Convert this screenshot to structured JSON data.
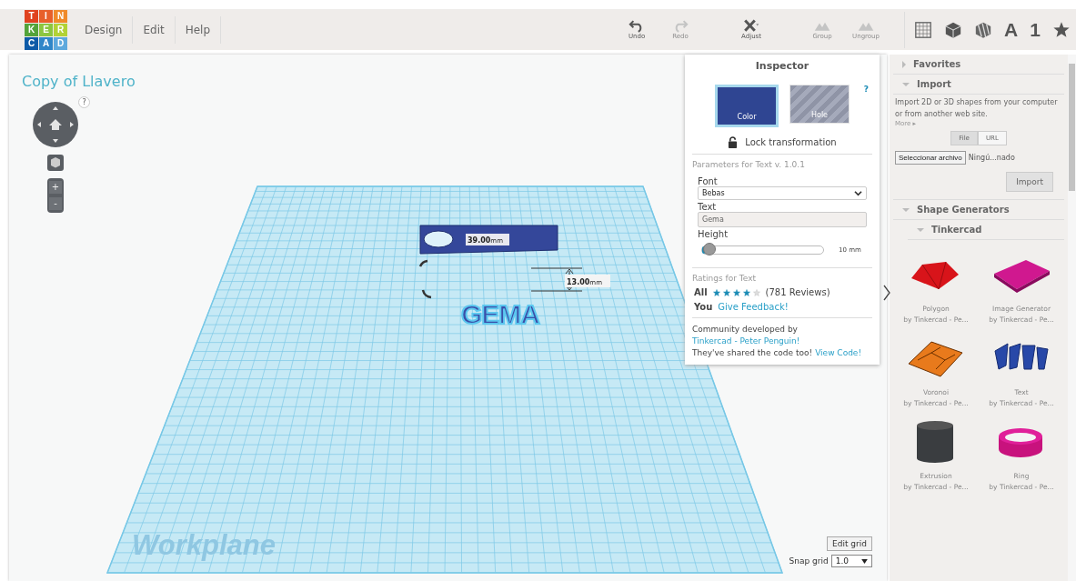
{
  "logo": {
    "letters": [
      "T",
      "I",
      "N",
      "K",
      "E",
      "R",
      "C",
      "A",
      "D"
    ]
  },
  "menu": [
    "Design",
    "Edit",
    "Help"
  ],
  "toolbar": [
    {
      "kind": "undo",
      "label": "Undo",
      "disabled": false
    },
    {
      "kind": "redo",
      "label": "Redo",
      "disabled": true
    },
    {
      "kind": "adjust",
      "label": "Adjust",
      "disabled": false
    },
    {
      "kind": "group",
      "label": "Group",
      "disabled": true
    },
    {
      "kind": "ungroup",
      "label": "Ungroup",
      "disabled": true
    }
  ],
  "view_tabs": [
    {
      "kind": "grid"
    },
    {
      "kind": "cube"
    },
    {
      "kind": "striped"
    },
    {
      "kind": "letter",
      "label": "A"
    },
    {
      "kind": "letter",
      "label": "1"
    },
    {
      "kind": "star"
    }
  ],
  "design_title": "Copy of Llavero",
  "nav": {
    "help": "?",
    "zoom_in": "+",
    "zoom_out": "-"
  },
  "workplane": {
    "label": "Workplane",
    "object_text": "GEMA",
    "width_dim": "39.00",
    "width_unit": "mm",
    "height_dim": "13.00",
    "height_unit": "mm",
    "edit_grid": "Edit grid",
    "snap_label": "Snap grid",
    "snap_value": "1.0"
  },
  "inspector": {
    "title": "Inspector",
    "help": "?",
    "modes": [
      {
        "kind": "color",
        "label": "Color",
        "selected": true
      },
      {
        "kind": "hole",
        "label": "Hole",
        "selected": false
      }
    ],
    "lock": "Lock transformation",
    "params_title": "Parameters for Text v. 1.0.1",
    "font_label": "Font",
    "font_value": "Bebas",
    "text_label": "Text",
    "text_value": "Gema",
    "height": {
      "label": "Height",
      "level": 0.03,
      "reading": "10 mm"
    },
    "ratings_title": "Ratings for Text",
    "all_label": "All",
    "stars": 4,
    "reviews": "(781 Reviews)",
    "you_label": "You",
    "feedback": "Give Feedback!",
    "credit": [
      {
        "text": "Community developed by",
        "link": false
      },
      {
        "text": "Tinkercad - Peter Penguin!",
        "link": true
      }
    ],
    "share": [
      {
        "text": "They've shared the code too!",
        "link": false
      },
      {
        "text": "View Code!",
        "link": true
      }
    ]
  },
  "sidebar": {
    "favorites": {
      "label": "Favorites",
      "expanded": false
    },
    "import": {
      "label": "Import",
      "expanded": true,
      "description": "Import 2D or 3D shapes from your computer or from another web site.",
      "more": "More ▸",
      "sources": [
        {
          "label": "File",
          "selected": true
        },
        {
          "label": "URL",
          "selected": false
        }
      ],
      "choose_file": "Seleccionar archivo",
      "file_status": "Ningú...nado",
      "import_button": "Import"
    },
    "generators": {
      "label": "Shape Generators",
      "expanded": true,
      "group": "Tinkercad",
      "group_expanded": true,
      "shapes": [
        {
          "kind": "polygon",
          "name": "Polygon",
          "author": "by Tinkercad - Pe..."
        },
        {
          "kind": "image",
          "name": "Image Generator",
          "author": "by Tinkercad - Pe..."
        },
        {
          "kind": "voronoi",
          "name": "Voronoi",
          "author": "by Tinkercad - Pe..."
        },
        {
          "kind": "text",
          "name": "Text",
          "author": "by Tinkercad - Pe..."
        },
        {
          "kind": "extrusion",
          "name": "Extrusion",
          "author": "by Tinkercad - Pe..."
        },
        {
          "kind": "ring",
          "name": "Ring",
          "author": "by Tinkercad - Pe..."
        }
      ]
    }
  }
}
